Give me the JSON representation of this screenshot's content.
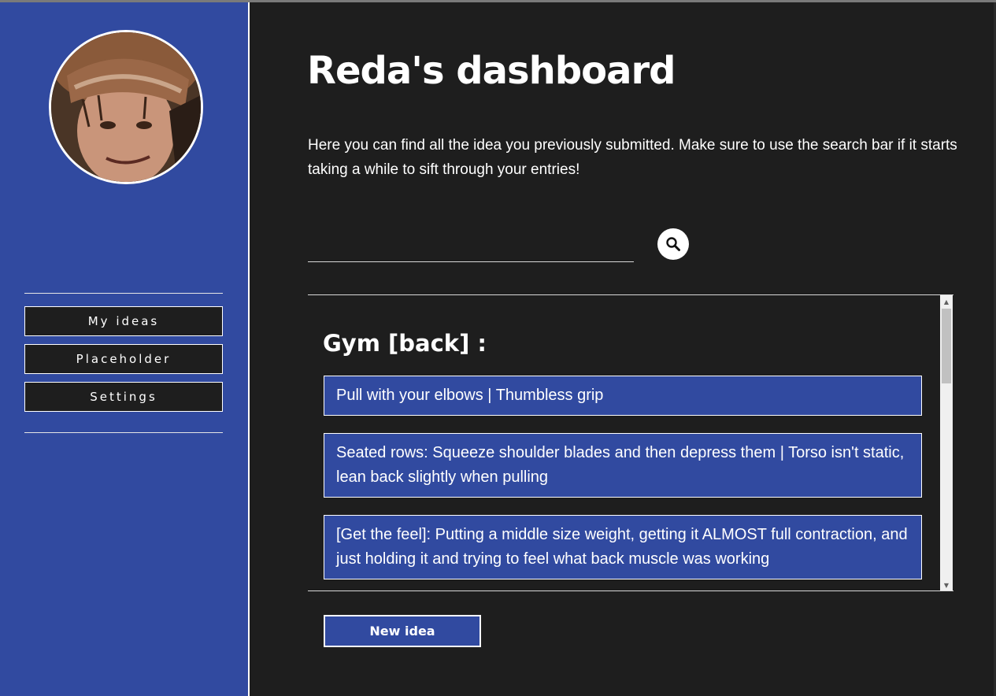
{
  "header": {
    "title": "Reda's dashboard",
    "intro": "Here you can find all the idea you previously submitted. Make sure to use the search bar if it starts taking a while to sift through your entries!"
  },
  "sidebar": {
    "avatar_icon": "user-photo",
    "items": [
      {
        "label": "My ideas"
      },
      {
        "label": "Placeholder"
      },
      {
        "label": "Settings"
      }
    ]
  },
  "search": {
    "value": "",
    "placeholder": "",
    "icon": "search-icon"
  },
  "ideas_panel": {
    "category": "Gym [back] :",
    "ideas": [
      {
        "text": "Pull with your elbows | Thumbless grip"
      },
      {
        "text": "Seated rows: Squeeze shoulder blades and then depress them | Torso isn't static, lean back slightly when pulling"
      },
      {
        "text": "[Get the feel]: Putting a middle size weight, getting it ALMOST full contraction, and just holding it and trying to feel what back muscle was working"
      }
    ]
  },
  "actions": {
    "new_idea_label": "New idea"
  },
  "colors": {
    "primary_blue": "#314aa0",
    "background": "#1e1e1e",
    "text": "#ffffff"
  }
}
